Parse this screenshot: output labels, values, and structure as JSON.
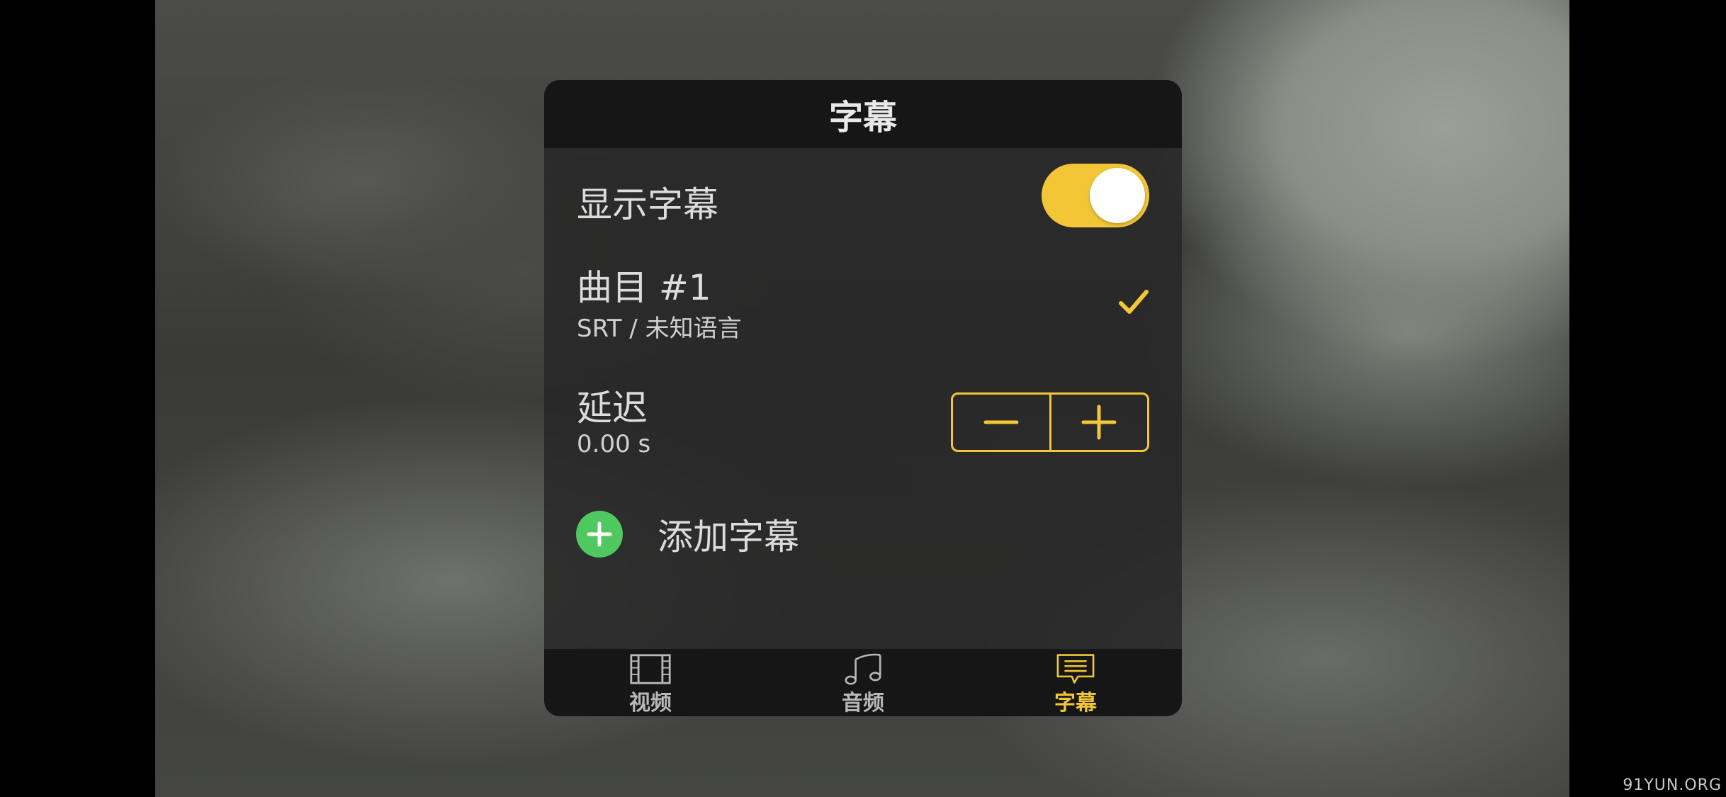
{
  "panel": {
    "title": "字幕",
    "show_subtitles": {
      "label": "显示字幕",
      "enabled": true
    },
    "track": {
      "title": "曲目 #1",
      "subtitle": "SRT / 未知语言",
      "selected": true
    },
    "delay": {
      "label": "延迟",
      "value": "0.00 s"
    },
    "add_subtitle": {
      "label": "添加字幕"
    }
  },
  "tabs": [
    {
      "label": "视频",
      "icon": "film-icon",
      "active": false
    },
    {
      "label": "音频",
      "icon": "music-note-icon",
      "active": false
    },
    {
      "label": "字幕",
      "icon": "subtitle-bubble-icon",
      "active": true
    }
  ],
  "watermark": "91YUN.ORG",
  "colors": {
    "accent": "#f2c636",
    "add_green": "#4fc95f",
    "tab_inactive": "#b8b8b8"
  }
}
